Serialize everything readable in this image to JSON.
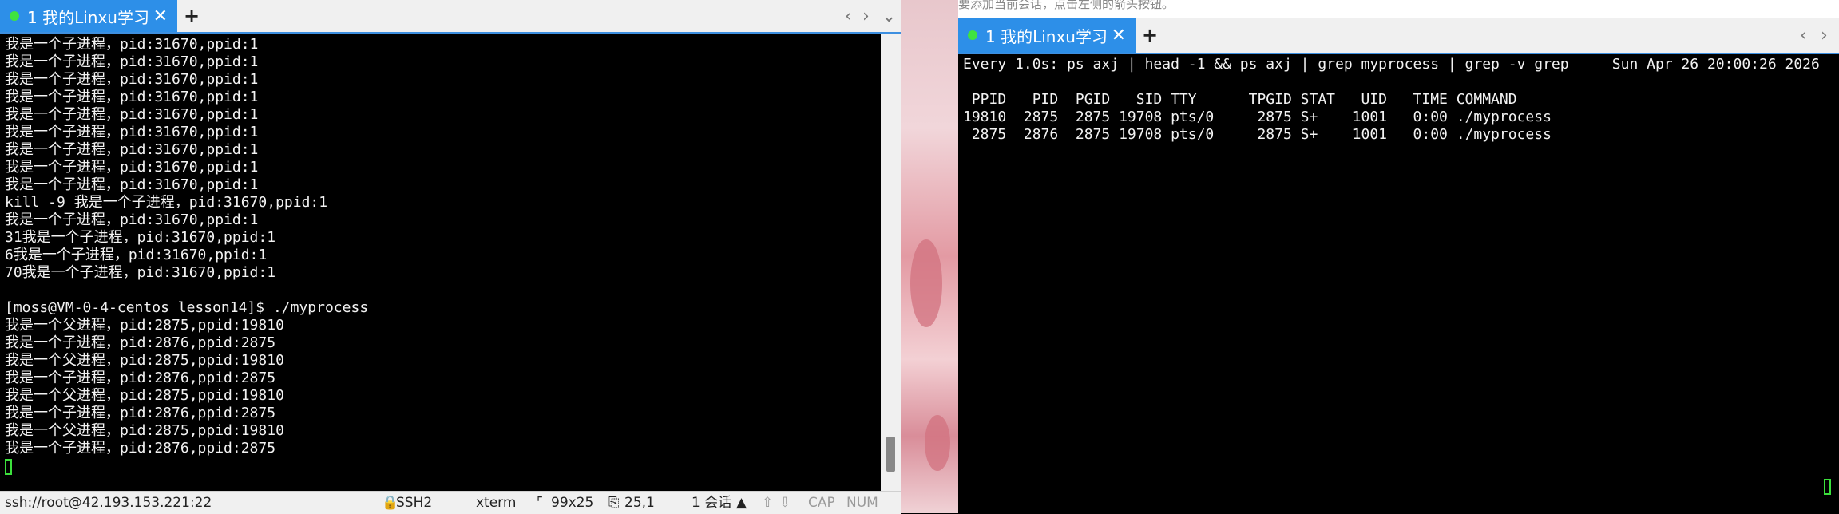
{
  "left": {
    "tab": {
      "title": "1 我的Linxu学习",
      "close": "✕"
    },
    "add_tab": "+",
    "nav": {
      "prev": "‹",
      "next": "›",
      "menu": "⌄"
    },
    "lines": [
      "我是一个子进程，pid:31670,ppid:1",
      "我是一个子进程，pid:31670,ppid:1",
      "我是一个子进程，pid:31670,ppid:1",
      "我是一个子进程，pid:31670,ppid:1",
      "我是一个子进程，pid:31670,ppid:1",
      "我是一个子进程，pid:31670,ppid:1",
      "我是一个子进程，pid:31670,ppid:1",
      "我是一个子进程，pid:31670,ppid:1",
      "我是一个子进程，pid:31670,ppid:1",
      "kill -9 我是一个子进程，pid:31670,ppid:1",
      "我是一个子进程，pid:31670,ppid:1",
      "31我是一个子进程，pid:31670,ppid:1",
      "6我是一个子进程，pid:31670,ppid:1",
      "70我是一个子进程，pid:31670,ppid:1",
      "",
      "[moss@VM-0-4-centos lesson14]$ ./myprocess",
      "我是一个父进程，pid:2875,ppid:19810",
      "我是一个子进程，pid:2876,ppid:2875",
      "我是一个父进程，pid:2875,ppid:19810",
      "我是一个子进程，pid:2876,ppid:2875",
      "我是一个父进程，pid:2875,ppid:19810",
      "我是一个子进程，pid:2876,ppid:2875",
      "我是一个父进程，pid:2875,ppid:19810",
      "我是一个子进程，pid:2876,ppid:2875"
    ],
    "status": {
      "connection": "ssh://root@42.193.153.221:22",
      "protocol": "SSH2",
      "term_type": "xterm",
      "size": "99x25",
      "position": "25,1",
      "sessions": "1 会话",
      "caps": "CAP",
      "num": "NUM"
    }
  },
  "right": {
    "notice": "要添加当前会话，点击左侧的箭头按钮。",
    "tab": {
      "title": "1 我的Linxu学习",
      "close": "✕"
    },
    "add_tab": "+",
    "nav": {
      "prev": "‹",
      "next": "›"
    },
    "lines": [
      "Every 1.0s: ps axj | head -1 && ps axj | grep myprocess | grep -v grep     Sun Apr 26 20:00:26 2026",
      "",
      " PPID   PID  PGID   SID TTY      TPGID STAT   UID   TIME COMMAND",
      "19810  2875  2875 19708 pts/0     2875 S+    1001   0:00 ./myprocess",
      " 2875  2876  2875 19708 pts/0     2875 S+    1001   0:00 ./myprocess"
    ]
  }
}
